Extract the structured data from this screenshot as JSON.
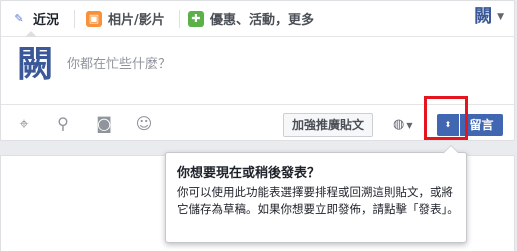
{
  "composer": {
    "tabs": [
      {
        "label": "近況",
        "icon": "pencil-icon"
      },
      {
        "label": "相片/影片",
        "icon": "photo-icon"
      },
      {
        "label": "優惠、活動，更多",
        "icon": "offer-icon"
      }
    ],
    "page_avatar_text": "闕",
    "avatar_text": "闕",
    "placeholder": "你都在忙些什麼？",
    "boost_label": "加強推廣貼文",
    "post_label": "留言"
  },
  "tooltip": {
    "title": "你想要現在或稍後發表？",
    "body": "你可以使用此功能表選擇要排程或回溯這則貼文，或將它儲存為草稿。如果你想要立即發佈，請點擊「發表」。"
  },
  "colors": {
    "accent": "#4267b2",
    "highlight": "#e4151f"
  }
}
